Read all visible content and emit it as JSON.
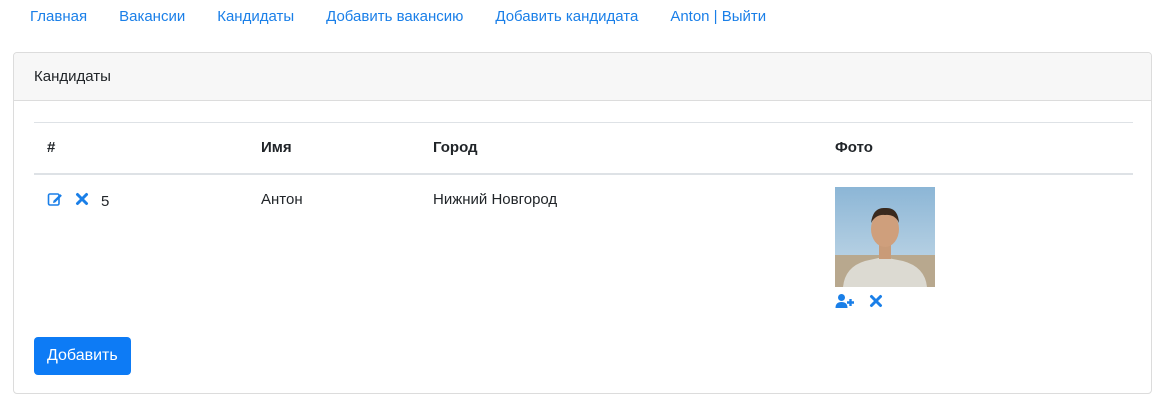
{
  "nav": {
    "items": [
      {
        "label": "Главная"
      },
      {
        "label": "Вакансии"
      },
      {
        "label": "Кандидаты"
      },
      {
        "label": "Добавить вакансию"
      },
      {
        "label": "Добавить кандидата"
      },
      {
        "label": "Anton | Выйти"
      }
    ]
  },
  "card": {
    "title": "Кандидаты",
    "add_button": "Добавить"
  },
  "table": {
    "headers": {
      "num": "#",
      "name": "Имя",
      "city": "Город",
      "photo": "Фото"
    },
    "rows": [
      {
        "id": "5",
        "name": "Антон",
        "city": "Нижний Новгород"
      }
    ]
  },
  "icons": {
    "edit": "edit-icon",
    "delete": "times-icon",
    "upload_photo": "user-plus-icon",
    "delete_photo": "times-icon"
  },
  "colors": {
    "link": "#1a7fe8",
    "primary": "#0d7bf5"
  }
}
